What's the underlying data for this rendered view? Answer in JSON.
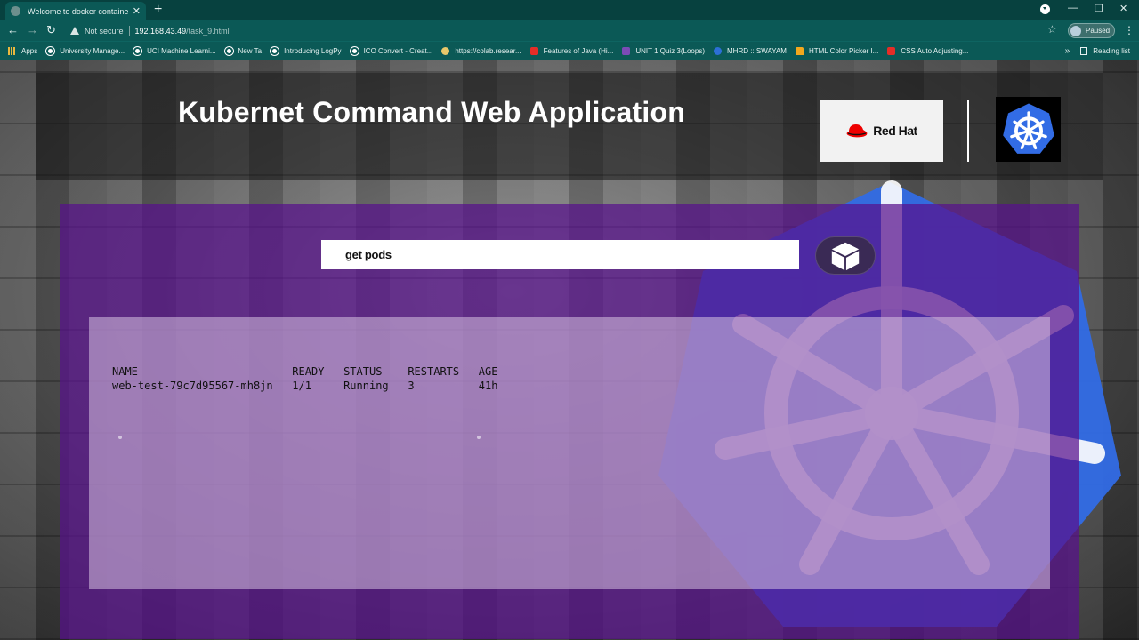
{
  "browser": {
    "tab_title": "Welcome to docker container",
    "security_label": "Not secure",
    "url_host": "192.168.43.49",
    "url_path": "/task_9.html",
    "profile_label": "Paused",
    "bookmarks": [
      {
        "label": "Apps",
        "icon": "apps-grid-icon"
      },
      {
        "label": "University Manage...",
        "icon": "globe-icon"
      },
      {
        "label": "UCI Machine Learni...",
        "icon": "globe-icon"
      },
      {
        "label": "New Ta",
        "icon": "globe-icon"
      },
      {
        "label": "Introducing LogPy",
        "icon": "globe-icon"
      },
      {
        "label": "ICO Convert - Creat...",
        "icon": "globe-icon"
      },
      {
        "label": "https://colab.resear...",
        "icon": "colab-icon"
      },
      {
        "label": "Features of Java (Hi...",
        "icon": "youtube-icon"
      },
      {
        "label": "UNIT 1 Quiz 3(Loops)",
        "icon": "form-icon"
      },
      {
        "label": "MHRD :: SWAYAM",
        "icon": "swayam-icon"
      },
      {
        "label": "HTML Color Picker I...",
        "icon": "w3-icon"
      },
      {
        "label": "CSS Auto Adjusting...",
        "icon": "youtube-icon"
      }
    ],
    "reading_list_label": "Reading list"
  },
  "page": {
    "title": "Kubernet Command Web Application",
    "redhat_label": "Red Hat",
    "command_value": "get pods",
    "output_lines": [
      "NAME                        READY   STATUS    RESTARTS   AGE",
      "web-test-79c7d95567-mh8jn   1/1     Running   3          41h"
    ]
  },
  "colors": {
    "chrome_teal": "#0b5956",
    "panel_purple": "#58108c",
    "k8s_blue": "#326ce5",
    "redhat_red": "#ee0000"
  }
}
